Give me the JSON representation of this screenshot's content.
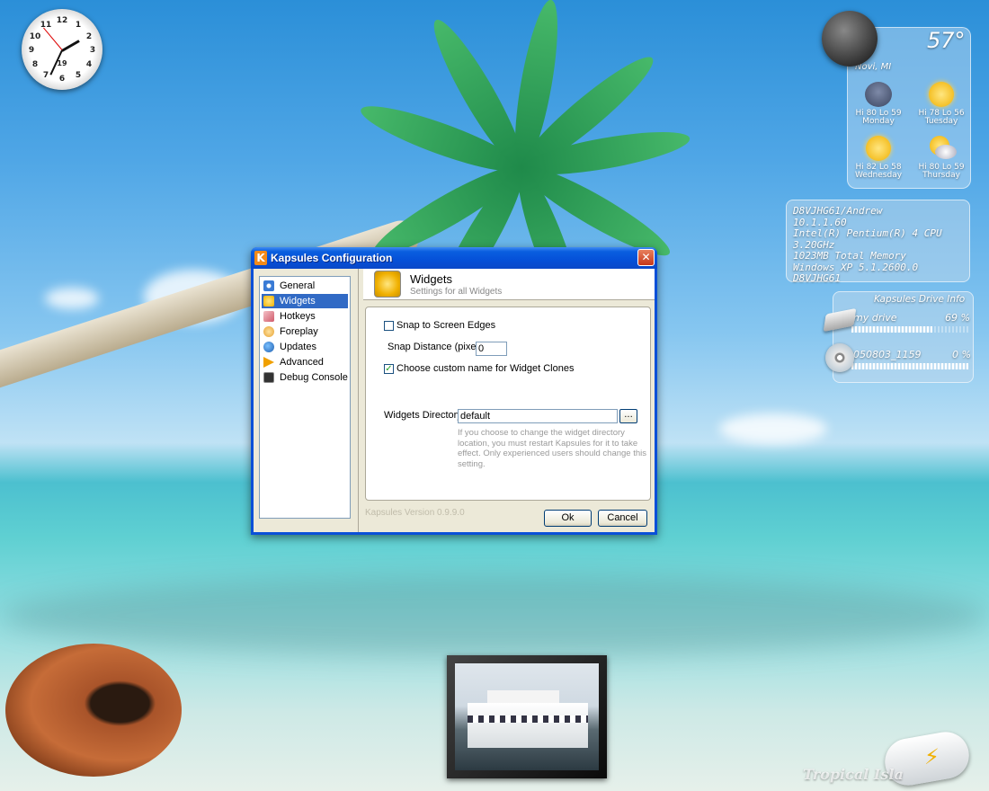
{
  "clock": {
    "numbers": [
      "12",
      "1",
      "2",
      "3",
      "4",
      "5",
      "6",
      "7",
      "8",
      "9",
      "10",
      "11"
    ],
    "date": "19"
  },
  "weather": {
    "temperature": "57°",
    "location": "Novi, MI",
    "days": [
      {
        "hilo": "Hi 80 Lo 59",
        "day": "Monday",
        "icon": "storm-icon"
      },
      {
        "hilo": "Hi 78 Lo 56",
        "day": "Tuesday",
        "icon": "sun-icon"
      },
      {
        "hilo": "Hi 82 Lo 58",
        "day": "Wednesday",
        "icon": "sun-cloud-icon"
      },
      {
        "hilo": "Hi 80 Lo 59",
        "day": "Thursday",
        "icon": "cloudy-sun-icon"
      }
    ]
  },
  "sysinfo": {
    "lines": [
      "D8VJHG61/Andrew",
      "10.1.1.60",
      "Intel(R) Pentium(R) 4 CPU 3.20GHz",
      "1023MB Total Memory",
      "Windows XP 5.1.2600.0",
      "D8VJHG61"
    ]
  },
  "drive_info": {
    "title": "Kapsules Drive Info",
    "drives": [
      {
        "name": "my drive",
        "percent_label": "69 %",
        "used": 0.69,
        "icon": "hard-drive-icon"
      },
      {
        "name": "050803_1159",
        "percent_label": "0 %",
        "used": 0.0,
        "icon": "cd-icon"
      }
    ]
  },
  "desktop": {
    "brand": "Tropical Isla... Maldives",
    "brand_visible": "Tropical Isla"
  },
  "dialog": {
    "title": "Kapsules Configuration",
    "close_label": "✕",
    "nav": [
      {
        "label": "General",
        "icon": "gear-icon",
        "color": "#3a7bd5"
      },
      {
        "label": "Widgets",
        "icon": "widget-sun-icon",
        "color": "#f0b000",
        "selected": true
      },
      {
        "label": "Hotkeys",
        "icon": "keyboard-icon",
        "color": "#d05a6a"
      },
      {
        "label": "Foreplay",
        "icon": "star-icon",
        "color": "#e6a030"
      },
      {
        "label": "Updates",
        "icon": "globe-icon",
        "color": "#3b8fd8"
      },
      {
        "label": "Advanced",
        "icon": "arrow-icon",
        "color": "#f0a000"
      },
      {
        "label": "Debug Console",
        "icon": "console-icon",
        "color": "#333333"
      }
    ],
    "header": {
      "title": "Widgets",
      "subtitle": "Settings for all Widgets"
    },
    "settings": {
      "snap_label": "Snap to Screen Edges",
      "snap_checked": false,
      "snap_distance_label": "Snap Distance (pixels)",
      "snap_distance_value": "0",
      "custom_name_label": "Choose custom name for Widget Clones",
      "custom_name_checked": true,
      "dir_label": "Widgets Directory",
      "dir_value": "default",
      "browse_label": "...",
      "dir_note": "If you choose to change the widget directory location, you must restart Kapsules for it to take effect. Only experienced users should change this setting."
    },
    "version": "Kapsules Version 0.9.9.0",
    "ok_label": "Ok",
    "cancel_label": "Cancel"
  }
}
